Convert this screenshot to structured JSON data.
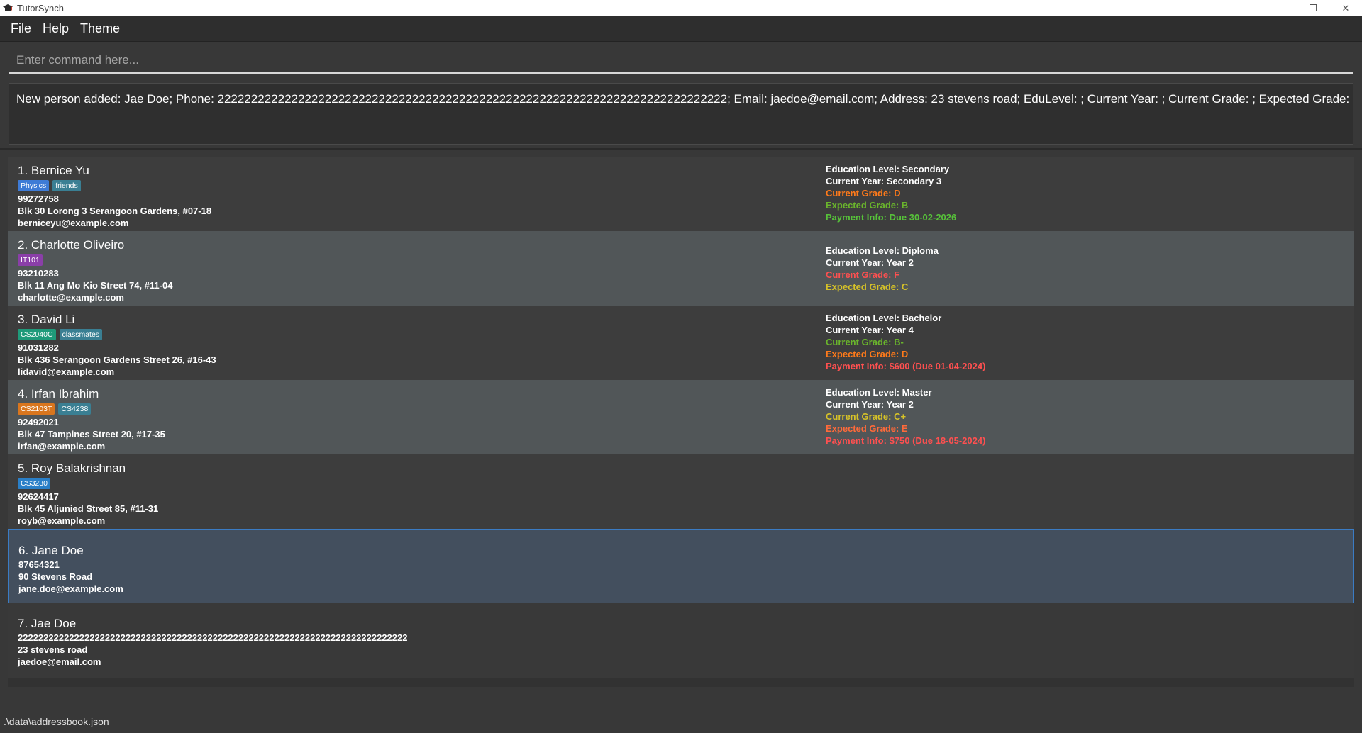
{
  "window": {
    "title": "TutorSynch",
    "minimize": "–",
    "maximize": "❐",
    "close": "✕"
  },
  "menu": [
    "File",
    "Help",
    "Theme"
  ],
  "command": {
    "placeholder": "Enter command here..."
  },
  "result": "New person added: Jae Doe; Phone: 2222222222222222222222222222222222222222222222222222222222222222222222222222; Email: jaedoe@email.com; Address: 23 stevens road; EduLevel: ; Current Year: ; Current Grade: ; Expected Grade: ; Tags:",
  "colors": {
    "white": "#ffffff",
    "grade_green": "#5fbf3a",
    "grade_orange": "#ff8a1e",
    "grade_red": "#ff5a5a",
    "grade_yellow": "#d8c23a"
  },
  "persons": [
    {
      "name": "1. Bernice Yu",
      "tags": [
        {
          "label": "Physics",
          "color": "#3e7bd6"
        },
        {
          "label": "friends",
          "color": "#3a7f93"
        }
      ],
      "phone": "99272758",
      "address": "Blk 30 Lorong 3 Serangoon Gardens, #07-18",
      "email": "berniceyu@example.com",
      "info": [
        {
          "text": "Education Level: Secondary",
          "color": "#ffffff"
        },
        {
          "text": "Current Year: Secondary 3",
          "color": "#ffffff"
        },
        {
          "text": "Current Grade: D",
          "color": "#ff7a1a"
        },
        {
          "text": "Expected Grade: B",
          "color": "#6ab52c"
        },
        {
          "text": "Payment Info: Due 30-02-2026",
          "color": "#57c23a"
        }
      ]
    },
    {
      "name": "2. Charlotte Oliveiro",
      "tags": [
        {
          "label": "IT101",
          "color": "#8a3fa8"
        }
      ],
      "phone": "93210283",
      "address": "Blk 11 Ang Mo Kio Street 74, #11-04",
      "email": "charlotte@example.com",
      "info": [
        {
          "text": "Education Level: Diploma",
          "color": "#ffffff"
        },
        {
          "text": "Current Year: Year 2",
          "color": "#ffffff"
        },
        {
          "text": "Current Grade: F",
          "color": "#ff5050"
        },
        {
          "text": "Expected Grade: C",
          "color": "#d6c228"
        }
      ]
    },
    {
      "name": "3. David Li",
      "tags": [
        {
          "label": "CS2040C",
          "color": "#1f9a7a"
        },
        {
          "label": "classmates",
          "color": "#3a7f93"
        }
      ],
      "phone": "91031282",
      "address": "Blk 436 Serangoon Gardens Street 26, #16-43",
      "email": "lidavid@example.com",
      "info": [
        {
          "text": "Education Level: Bachelor",
          "color": "#ffffff"
        },
        {
          "text": "Current Year: Year 4",
          "color": "#ffffff"
        },
        {
          "text": "Current Grade: B-",
          "color": "#6ab52c"
        },
        {
          "text": "Expected Grade: D",
          "color": "#ff7a1a"
        },
        {
          "text": "Payment Info: $600 (Due 01-04-2024)",
          "color": "#ff5050"
        }
      ]
    },
    {
      "name": "4. Irfan Ibrahim",
      "tags": [
        {
          "label": "CS2103T",
          "color": "#d9761e"
        },
        {
          "label": "CS4238",
          "color": "#3a7f93"
        }
      ],
      "phone": "92492021",
      "address": "Blk 47 Tampines Street 20, #17-35",
      "email": "irfan@example.com",
      "info": [
        {
          "text": "Education Level: Master",
          "color": "#ffffff"
        },
        {
          "text": "Current Year: Year 2",
          "color": "#ffffff"
        },
        {
          "text": "Current Grade: C+",
          "color": "#d6c228"
        },
        {
          "text": "Expected Grade: E",
          "color": "#ff6a3a"
        },
        {
          "text": "Payment Info: $750 (Due 18-05-2024)",
          "color": "#ff5050"
        }
      ]
    },
    {
      "name": "5. Roy Balakrishnan",
      "tags": [
        {
          "label": "CS3230",
          "color": "#2a7fc7"
        }
      ],
      "phone": "92624417",
      "address": "Blk 45 Aljunied Street 85, #11-31",
      "email": "royb@example.com",
      "info": []
    },
    {
      "name": "6. Jane Doe",
      "tags": [],
      "phone": "87654321",
      "address": "90 Stevens Road",
      "email": "jane.doe@example.com",
      "info": []
    },
    {
      "name": "7. Jae Doe",
      "tags": [],
      "phone": "2222222222222222222222222222222222222222222222222222222222222222222222222222",
      "address": "23 stevens road",
      "email": "jaedoe@email.com",
      "info": []
    }
  ],
  "status": {
    "path": ".\\data\\addressbook.json"
  }
}
